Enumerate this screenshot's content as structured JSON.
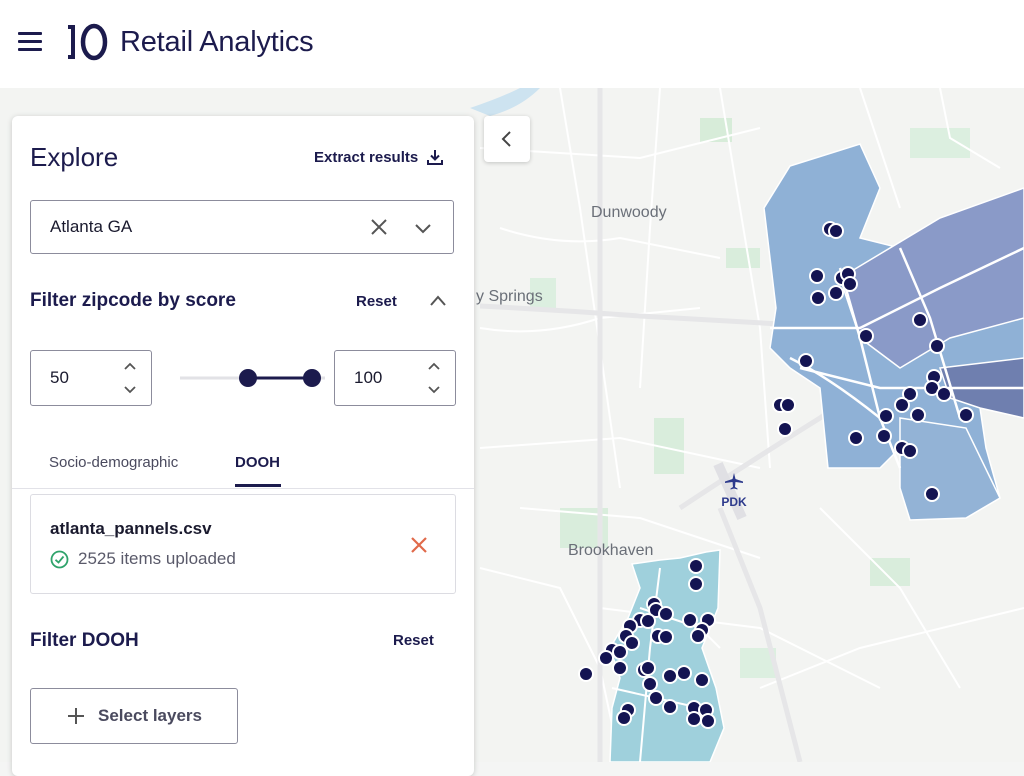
{
  "app": {
    "title": "Retail Analytics",
    "logo_text": "10"
  },
  "panel": {
    "title": "Explore",
    "extract_label": "Extract results",
    "location_select": {
      "value": "Atlanta GA"
    },
    "filter_score": {
      "title": "Filter zipcode by score",
      "reset_label": "Reset",
      "min_value": "50",
      "max_value": "100",
      "range_min": 0,
      "range_max": 100,
      "selected_min": 50,
      "selected_max": 100
    },
    "tabs": [
      {
        "label": "Socio-demographic",
        "active": false
      },
      {
        "label": "DOOH",
        "active": true
      }
    ],
    "file": {
      "name": "atlanta_pannels.csv",
      "status": "2525 items uploaded"
    },
    "filter_dooh": {
      "title": "Filter DOOH",
      "reset_label": "Reset"
    },
    "add_layer_label": "Select layers"
  },
  "map": {
    "labels": {
      "dunwoody": "Dunwoody",
      "sandy_springs": "y Springs",
      "brookhaven": "Brookhaven",
      "airport": "PDK"
    },
    "colors": {
      "region_north": "#8fb1d6",
      "region_south": "#9fd0dc",
      "region_east": "#8a9ac8",
      "marker": "#141452",
      "road": "#ffffff",
      "water": "#cde3f0",
      "park": "#d7ecd9"
    }
  },
  "colors": {
    "brand": "#1c1b4d",
    "remove": "#e06a4a",
    "success": "#2fa36b"
  }
}
